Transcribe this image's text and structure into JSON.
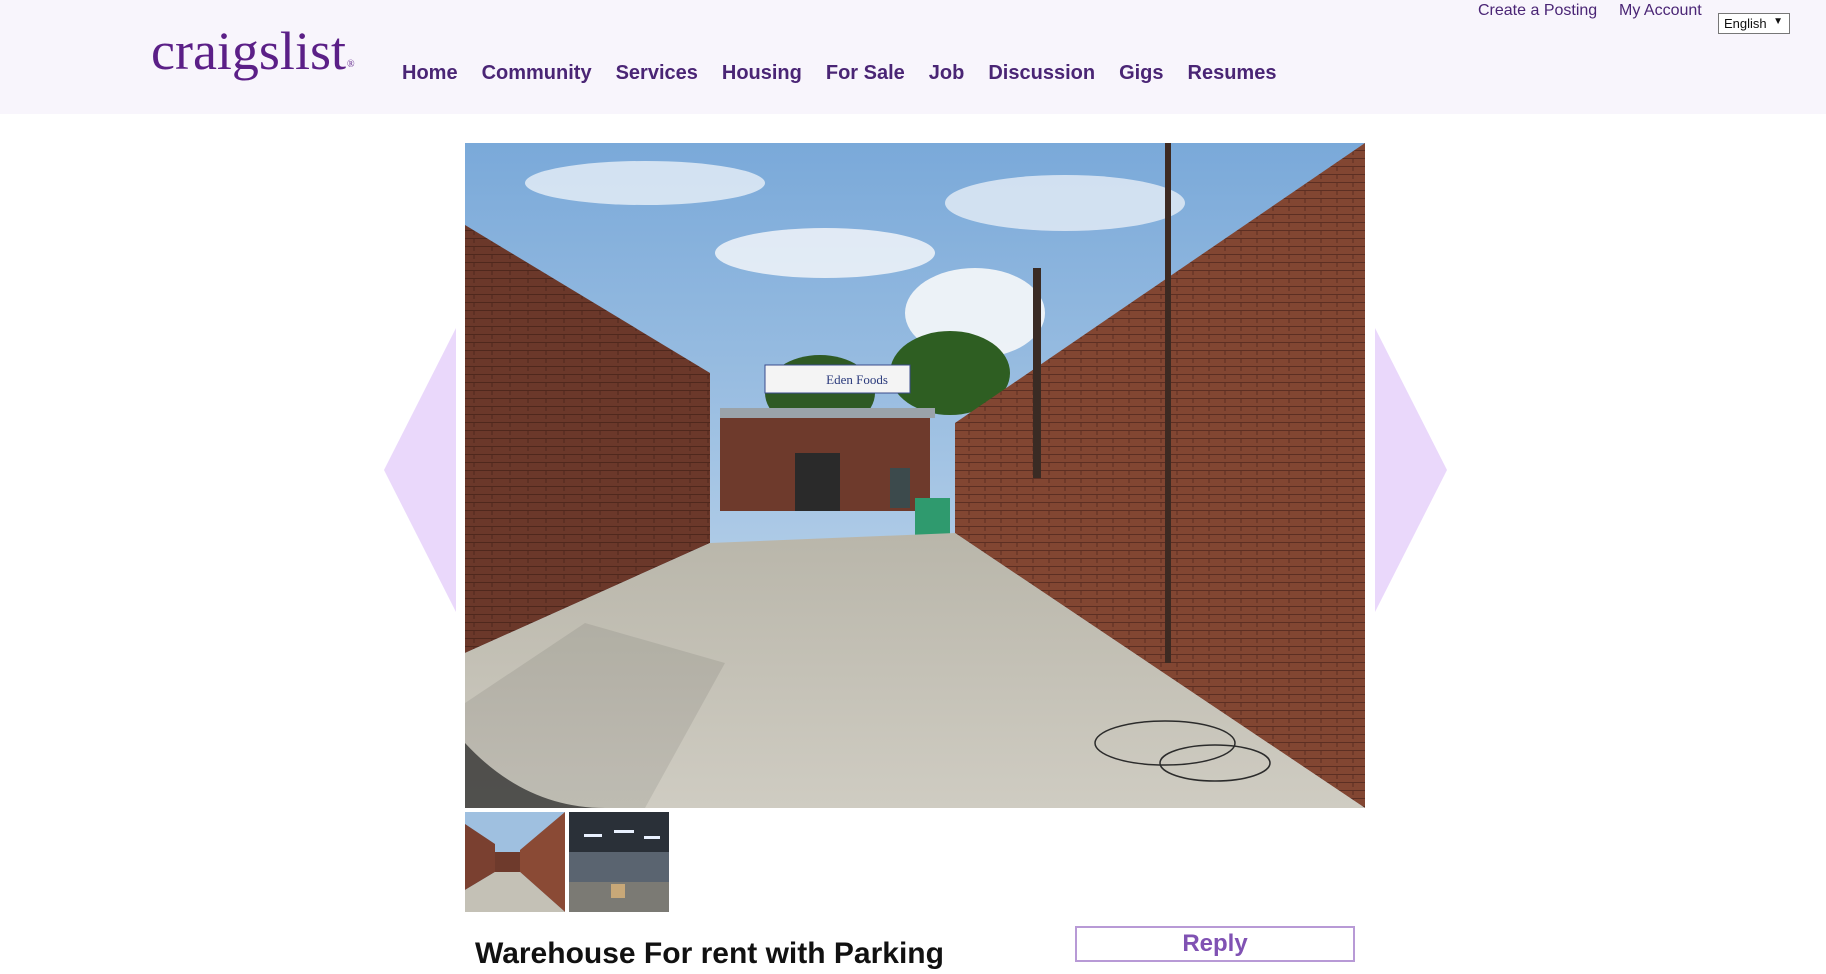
{
  "header": {
    "logo_text": "craigslist",
    "logo_mark": "®",
    "nav": [
      "Home",
      "Community",
      "Services",
      "Housing",
      "For Sale",
      "Job",
      "Discussion",
      "Gigs",
      "Resumes"
    ],
    "create_posting": "Create a Posting",
    "my_account": "My Account",
    "language": "English"
  },
  "listing": {
    "photo_sign": "Eden Foods",
    "title": "Warehouse For rent with Parking",
    "reply_label": "Reply"
  },
  "colors": {
    "brand": "#5b1f87",
    "nav": "#4a2575",
    "header_bg": "#f8f5fc",
    "arrow": "#ead8fb",
    "reply_border": "#b89ad6",
    "reply_text": "#8052b3"
  }
}
